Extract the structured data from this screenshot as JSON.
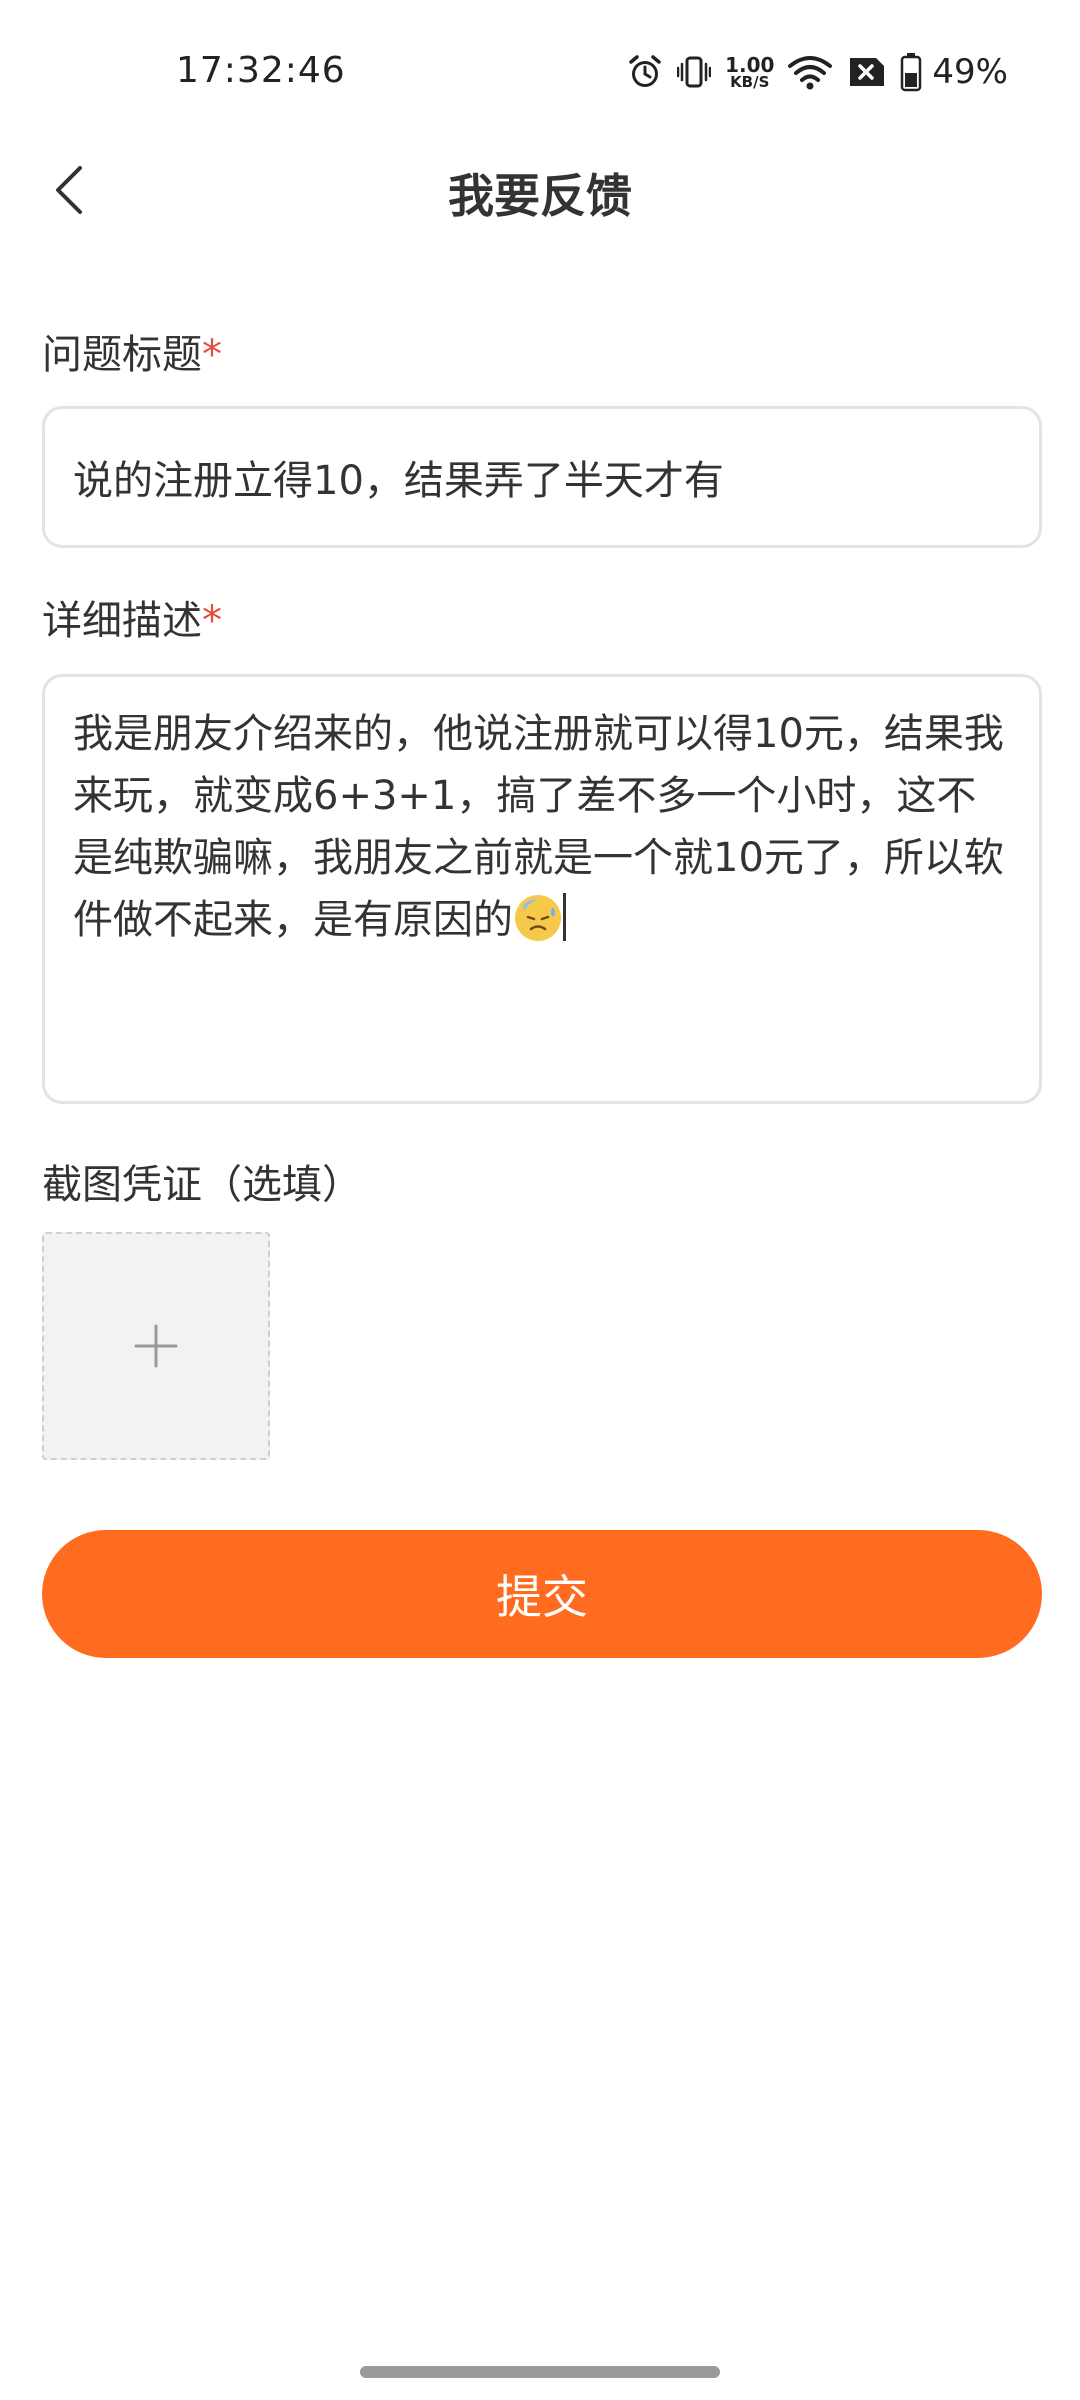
{
  "status_bar": {
    "time": "17:32:46",
    "net_speed_value": "1.00",
    "net_speed_unit": "KB/S",
    "battery_percent": "49%",
    "icons": [
      "alarm-icon",
      "vibrate-icon",
      "wifi-icon",
      "no-sim-icon",
      "battery-icon"
    ]
  },
  "header": {
    "title": "我要反馈"
  },
  "form": {
    "title_field": {
      "label": "问题标题",
      "required_mark": "*",
      "value": "说的注册立得10，结果弄了半天才有"
    },
    "description_field": {
      "label": "详细描述",
      "required_mark": "*",
      "value": "我是朋友介绍来的，他说注册就可以得10元，结果我来玩，就变成6+3+1，搞了差不多一个小时，这不是纯欺骗嘛，我朋友之前就是一个就10元了，所以软件做不起来，是有原因的"
    },
    "screenshot_field": {
      "label": "截图凭证（选填）"
    },
    "submit_label": "提交"
  },
  "colors": {
    "accent": "#ff6b1f",
    "required": "#e64a3b",
    "border": "#e3e3e3"
  }
}
